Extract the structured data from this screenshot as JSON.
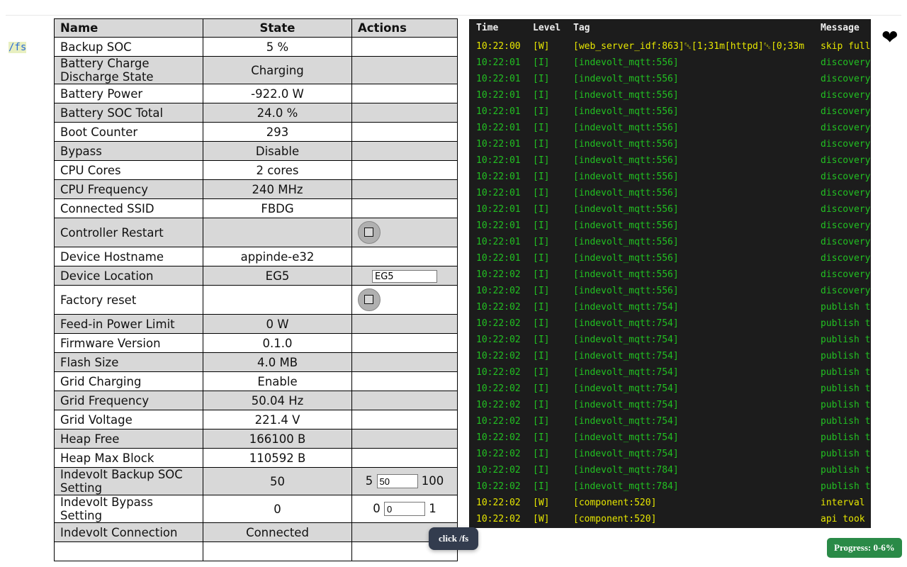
{
  "nav": {
    "fs_link": "/fs",
    "heart_icon": "heart-icon"
  },
  "table": {
    "headers": [
      "Name",
      "State",
      "Actions"
    ],
    "rows": [
      {
        "name": "Backup SOC",
        "state": "5 %"
      },
      {
        "name": "Battery Charge Discharge State",
        "state": "Charging"
      },
      {
        "name": "Battery Power",
        "state": "-922.0 W"
      },
      {
        "name": "Battery SOC Total",
        "state": "24.0 %"
      },
      {
        "name": "Boot Counter",
        "state": "293"
      },
      {
        "name": "Bypass",
        "state": "Disable"
      },
      {
        "name": "CPU Cores",
        "state": "2 cores"
      },
      {
        "name": "CPU Frequency",
        "state": "240 MHz"
      },
      {
        "name": "Connected SSID",
        "state": "FBDG"
      },
      {
        "name": "Controller Restart",
        "state": "",
        "action": "button"
      },
      {
        "name": "Device Hostname",
        "state": "appinde-e32"
      },
      {
        "name": "Device Location",
        "state": "EG5",
        "action": "text",
        "value": "EG5"
      },
      {
        "name": "Factory reset",
        "state": "",
        "action": "button"
      },
      {
        "name": "Feed-in Power Limit",
        "state": "0 W"
      },
      {
        "name": "Firmware Version",
        "state": "0.1.0"
      },
      {
        "name": "Flash Size",
        "state": "4.0 MB"
      },
      {
        "name": "Grid Charging",
        "state": "Enable"
      },
      {
        "name": "Grid Frequency",
        "state": "50.04 Hz"
      },
      {
        "name": "Grid Voltage",
        "state": "221.4 V"
      },
      {
        "name": "Heap Free",
        "state": "166100 B"
      },
      {
        "name": "Heap Max Block",
        "state": "110592 B"
      },
      {
        "name": "Indevolt Backup SOC Setting",
        "state": "50",
        "action": "number",
        "min": "5",
        "value": "50",
        "max": "100"
      },
      {
        "name": "Indevolt Bypass Setting",
        "state": "0",
        "action": "number",
        "min": "0",
        "value": "0",
        "max": "1"
      },
      {
        "name": "Indevolt Connection",
        "state": "Connected"
      },
      {
        "name": "",
        "state": ""
      }
    ]
  },
  "log": {
    "headers": [
      "Time",
      "Level",
      "Tag",
      "Message"
    ],
    "colors": {
      "W": "#e6e600",
      "I": "#22c022"
    },
    "rows": [
      [
        "10:22:00",
        "[W]",
        "[web_server_idf:863]␛[1;31m[httpd]␛[0;33m",
        "skip full"
      ],
      [
        "10:22:01",
        "[I]",
        "[indevolt_mqtt:556]",
        "discovery"
      ],
      [
        "10:22:01",
        "[I]",
        "[indevolt_mqtt:556]",
        "discovery"
      ],
      [
        "10:22:01",
        "[I]",
        "[indevolt_mqtt:556]",
        "discovery"
      ],
      [
        "10:22:01",
        "[I]",
        "[indevolt_mqtt:556]",
        "discovery"
      ],
      [
        "10:22:01",
        "[I]",
        "[indevolt_mqtt:556]",
        "discovery"
      ],
      [
        "10:22:01",
        "[I]",
        "[indevolt_mqtt:556]",
        "discovery"
      ],
      [
        "10:22:01",
        "[I]",
        "[indevolt_mqtt:556]",
        "discovery"
      ],
      [
        "10:22:01",
        "[I]",
        "[indevolt_mqtt:556]",
        "discovery"
      ],
      [
        "10:22:01",
        "[I]",
        "[indevolt_mqtt:556]",
        "discovery"
      ],
      [
        "10:22:01",
        "[I]",
        "[indevolt_mqtt:556]",
        "discovery"
      ],
      [
        "10:22:01",
        "[I]",
        "[indevolt_mqtt:556]",
        "discovery"
      ],
      [
        "10:22:01",
        "[I]",
        "[indevolt_mqtt:556]",
        "discovery"
      ],
      [
        "10:22:01",
        "[I]",
        "[indevolt_mqtt:556]",
        "discovery"
      ],
      [
        "10:22:02",
        "[I]",
        "[indevolt_mqtt:556]",
        "discovery"
      ],
      [
        "10:22:02",
        "[I]",
        "[indevolt_mqtt:556]",
        "discovery"
      ],
      [
        "10:22:02",
        "[I]",
        "[indevolt_mqtt:754]",
        "publish t"
      ],
      [
        "10:22:02",
        "[I]",
        "[indevolt_mqtt:754]",
        "publish t"
      ],
      [
        "10:22:02",
        "[I]",
        "[indevolt_mqtt:754]",
        "publish t"
      ],
      [
        "10:22:02",
        "[I]",
        "[indevolt_mqtt:754]",
        "publish t"
      ],
      [
        "10:22:02",
        "[I]",
        "[indevolt_mqtt:754]",
        "publish t"
      ],
      [
        "10:22:02",
        "[I]",
        "[indevolt_mqtt:754]",
        "publish t"
      ],
      [
        "10:22:02",
        "[I]",
        "[indevolt_mqtt:754]",
        "publish t"
      ],
      [
        "10:22:02",
        "[I]",
        "[indevolt_mqtt:754]",
        "publish t"
      ],
      [
        "10:22:02",
        "[I]",
        "[indevolt_mqtt:754]",
        "publish t"
      ],
      [
        "10:22:02",
        "[I]",
        "[indevolt_mqtt:754]",
        "publish t"
      ],
      [
        "10:22:02",
        "[I]",
        "[indevolt_mqtt:784]",
        "publish t"
      ],
      [
        "10:22:02",
        "[I]",
        "[indevolt_mqtt:784]",
        "publish t"
      ],
      [
        "10:22:02",
        "[W]",
        "[component:520]",
        "interval"
      ],
      [
        "10:22:02",
        "[W]",
        "[component:520]",
        "api took"
      ]
    ]
  },
  "overlay": {
    "tooltip": "click /fs",
    "progress": "Progress: 0-6%"
  }
}
